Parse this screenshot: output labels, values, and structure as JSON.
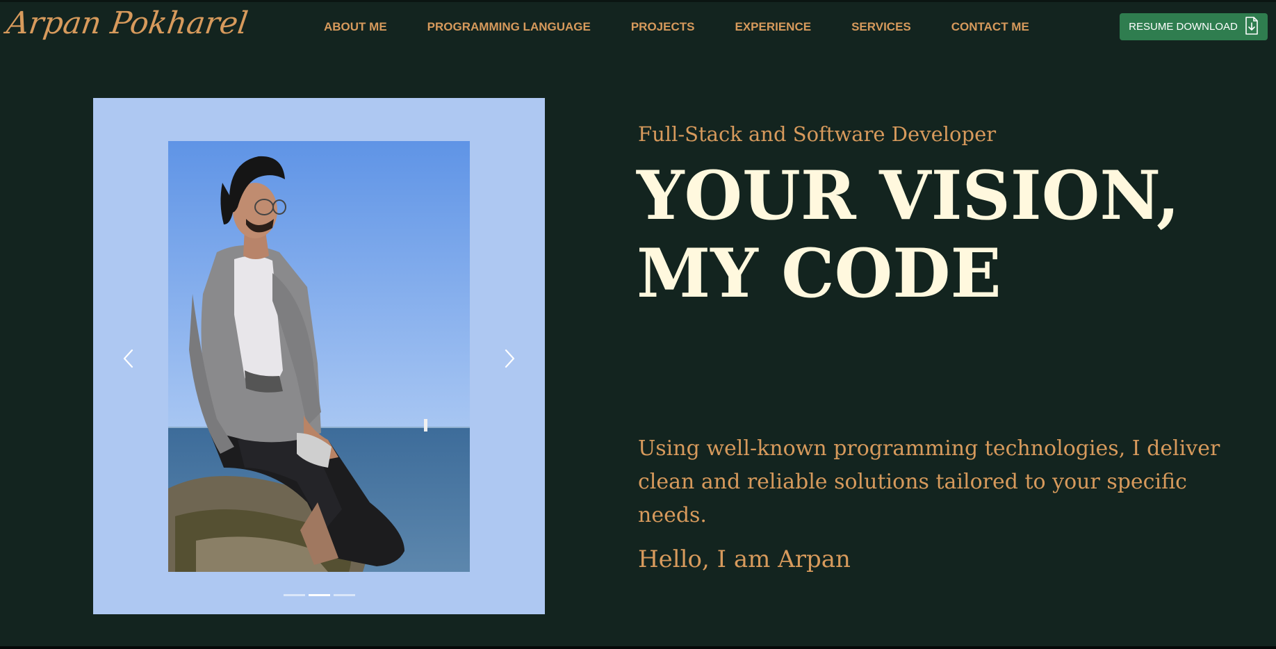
{
  "brand": {
    "logo_text": "Arpan Pokharel"
  },
  "nav": {
    "items": [
      {
        "label": "ABOUT ME"
      },
      {
        "label": "PROGRAMMING LANGUAGE"
      },
      {
        "label": "PROJECTS"
      },
      {
        "label": "EXPERIENCE"
      },
      {
        "label": "SERVICES"
      },
      {
        "label": "CONTACT ME"
      }
    ],
    "resume_button": {
      "label": "RESUME DOWNLOAD",
      "icon": "file-download-icon"
    }
  },
  "carousel": {
    "prev_icon": "chevron-left-icon",
    "next_icon": "chevron-right-icon",
    "slide_count": 3,
    "active_index": 1,
    "photo_alt": "Arpan sitting on a rock by the lake"
  },
  "hero": {
    "subtitle": "Full-Stack and Software Developer",
    "headline_line1": "YOUR VISION,",
    "headline_line2": "MY CODE",
    "description": "Using well-known programming technologies, I deliver clean and reliable solutions tailored to your specific needs.",
    "greeting": "Hello, I am Arpan"
  },
  "colors": {
    "background": "#13241f",
    "accent": "#d79a5c",
    "headline": "#fff8de",
    "button": "#2f7d4f",
    "carousel_bg": "#aec8f2"
  }
}
